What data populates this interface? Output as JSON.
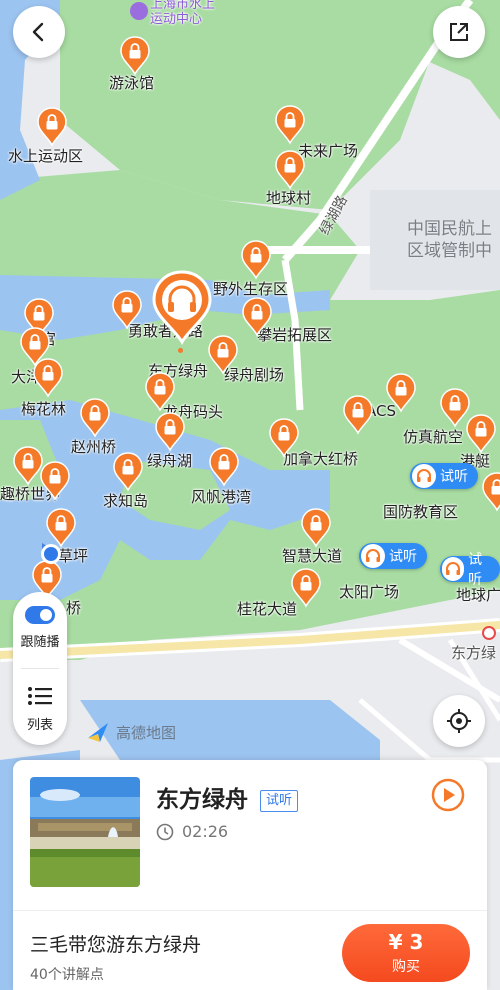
{
  "map": {
    "labels": {
      "shanghai_water_center": "上海市水上\n运动中心",
      "swimming_hall": "游泳馆",
      "water_sports_area": "水上运动区",
      "future_square": "未来广场",
      "earth_village": "地球村",
      "green_lake_road": "绿湖路",
      "caac_region": "中国民航上\n区域管制中",
      "wild_survival": "野外生存区",
      "brave_road": "勇敢者道路",
      "maze_palace": "迷宫",
      "climbing_area": "攀岩拓展区",
      "dongfang_lvzhou": "东方绿舟",
      "green_boat_theatre": "绿舟剧场",
      "dayang": "大洋",
      "plum_forest": "梅花林",
      "dragon_boat_pier": "龙舟码头",
      "acs": "ACS",
      "aviation_sim": "仿真航空",
      "zhaozhou_bridge": "赵州桥",
      "green_boat_lake": "绿舟湖",
      "canada_bridge": "加拿大红桥",
      "harbor_ship": "港艇",
      "bridge_world": "趣桥世界",
      "qiuzhi_island": "求知岛",
      "sail_harbor": "风帆港湾",
      "defense_edu": "国防教育区",
      "lawn": "草坪",
      "wisdom_avenue": "智慧大道",
      "sun_square": "太阳广场",
      "earth_square": "地球广",
      "osmanthus_avenue": "桂花大道",
      "bridge_bottom": "桥",
      "dongfang_lv": "东方绿",
      "amap_logo": "高德地图"
    },
    "trial_badges": [
      "试听",
      "试听",
      "试听"
    ]
  },
  "controls": {
    "follow_label": "跟随播",
    "list_label": "列表"
  },
  "card": {
    "title": "东方绿舟",
    "trial_tag": "试听",
    "duration": "02:26",
    "tour_title": "三毛带您游东方绿舟",
    "points_count": "40个讲解点",
    "price": "¥ 3",
    "buy_label": "购买"
  },
  "colors": {
    "pin_orange": "#f47a2a",
    "park_green": "#a8dca2",
    "water_blue": "#9cc4f0",
    "badge_blue": "#2f8cf5",
    "buy_red": "#f44a1f"
  }
}
